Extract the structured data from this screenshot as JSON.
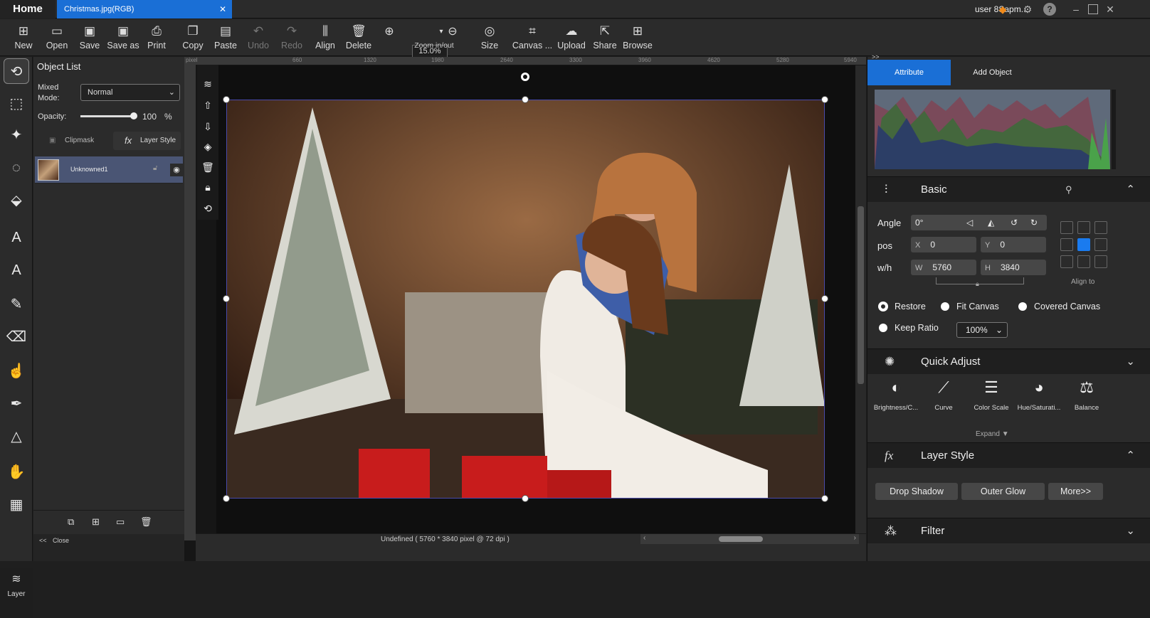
{
  "titlebar": {
    "home": "Home",
    "doc_tab": "Christmas.jpg(RGB)",
    "close": "✕",
    "user": "user 8Sapm..."
  },
  "toolbar": {
    "new": "New",
    "open": "Open",
    "save": "Save",
    "save_as": "Save as",
    "print": "Print",
    "copy": "Copy",
    "paste": "Paste",
    "undo": "Undo",
    "redo": "Redo",
    "align": "Align",
    "delete": "Delete",
    "zoom_value": "15.0%",
    "zoom_label": "Zoom in/out",
    "size": "Size",
    "canvas": "Canvas ...",
    "upload": "Upload",
    "share": "Share",
    "browse": "Browse"
  },
  "object_list": {
    "title": "Object List",
    "mixed_mode_label": "Mixed\nMode:",
    "mixed_mode_value": "Normal",
    "opacity_label": "Opacity:",
    "opacity_value": "100",
    "opacity_unit": "%",
    "opacity_level": 1.0,
    "clipmask": "Clipmask",
    "layer_style": "Layer Style",
    "layers": [
      {
        "name": "Unknowned1"
      }
    ],
    "layer_tab": "Layer",
    "close": "Close",
    "close_arrow": "<<"
  },
  "canvas": {
    "ruler_unit": "pixel",
    "ruler_marks": [
      "660",
      "1320",
      "1980",
      "2640",
      "3300",
      "3960",
      "4620",
      "5280",
      "5940"
    ],
    "status": "Undefined ( 5760 * 3840 pixel @ 72 dpi )"
  },
  "right_panel": {
    "expand_arrows": ">>",
    "tabs": [
      "Attribute",
      "Add Object"
    ],
    "basic": {
      "title": "Basic",
      "angle_label": "Angle",
      "angle_value": "0°",
      "pos_label": "pos",
      "x_key": "X",
      "x_value": "0",
      "y_key": "Y",
      "y_value": "0",
      "wh_label": "w/h",
      "w_key": "W",
      "w_value": "5760",
      "h_key": "H",
      "h_value": "3840",
      "align_to": "Align to",
      "restore": "Restore",
      "fit_canvas": "Fit Canvas",
      "covered_canvas": "Covered Canvas",
      "keep_ratio": "Keep Ratio",
      "ratio_value": "100%"
    },
    "quick_adjust": {
      "title": "Quick Adjust",
      "items": [
        "Brightness/C...",
        "Curve",
        "Color Scale",
        "Hue/Saturati...",
        "Balance"
      ],
      "expand": "Expand ▼"
    },
    "layer_style": {
      "title": "Layer Style",
      "drop_shadow": "Drop Shadow",
      "outer_glow": "Outer Glow",
      "more": "More>>"
    },
    "filter": {
      "title": "Filter"
    }
  },
  "colors": {
    "accent": "#1a6fd6",
    "panel": "#2b2b2b",
    "selected_layer": "#4a5574"
  }
}
